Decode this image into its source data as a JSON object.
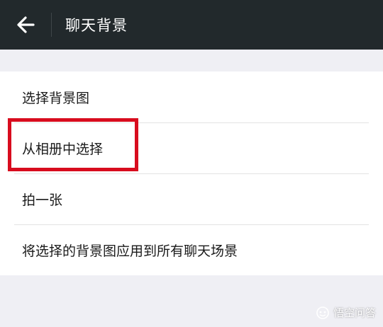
{
  "header": {
    "title": "聊天背景",
    "back_icon": "arrow-left-icon"
  },
  "list": {
    "items": [
      {
        "label": "选择背景图"
      },
      {
        "label": "从相册中选择"
      },
      {
        "label": "拍一张"
      },
      {
        "label": "将选择的背景图应用到所有聊天场景"
      }
    ]
  },
  "highlight": {
    "color": "#d80c1e",
    "target": "从相册中选择"
  },
  "watermark": {
    "text": "悟空问答",
    "icon": "wukong-logo-icon"
  },
  "colors": {
    "header_bg": "#22292c",
    "page_bg": "#efeff4",
    "list_bg": "#ffffff"
  }
}
